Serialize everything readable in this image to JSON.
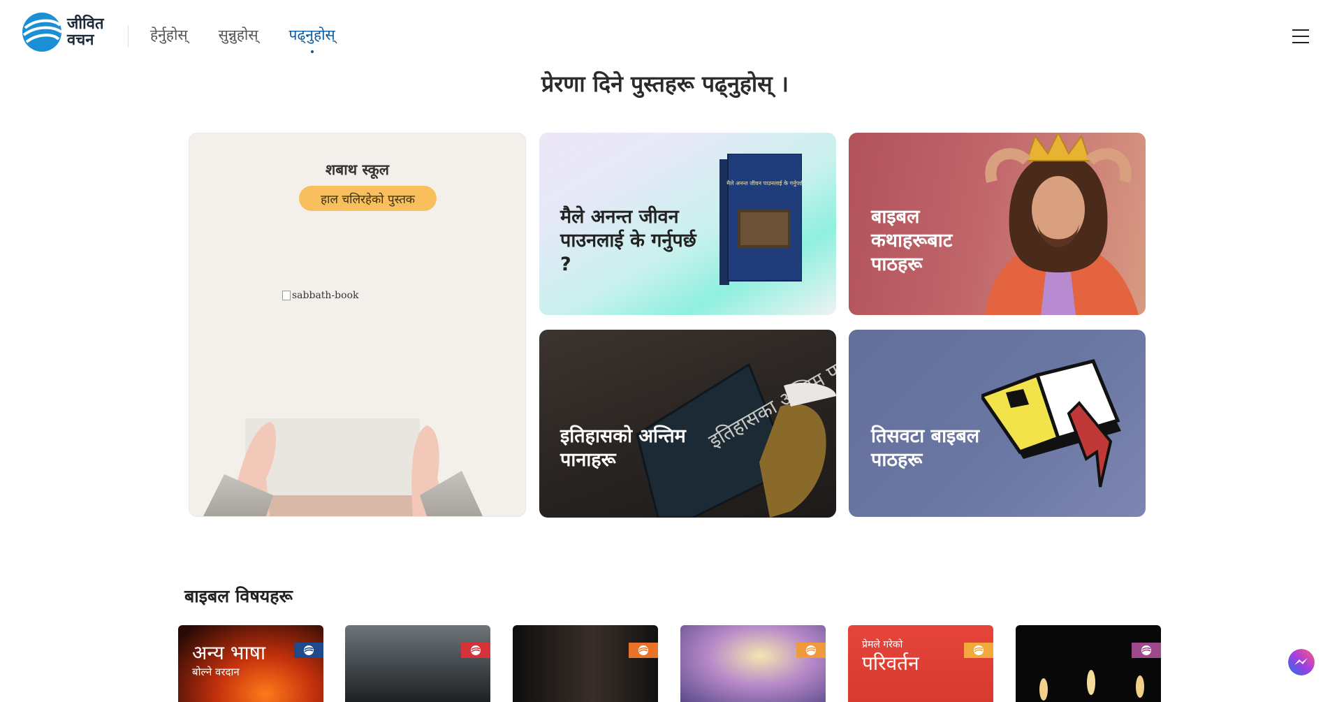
{
  "header": {
    "logo_line1": "जीवित",
    "logo_line2": "वचन",
    "nav": [
      {
        "label": "हेर्नुहोस्",
        "active": false
      },
      {
        "label": "सुन्नुहोस्",
        "active": false
      },
      {
        "label": "पढ्नुहोस्",
        "active": true
      }
    ],
    "menu_icon": "hamburger-icon"
  },
  "main": {
    "title": "प्रेरणा दिने पुस्तहरू पढ्नुहोस् ।",
    "sabbath_card": {
      "title": "शबाथ स्कूल",
      "pill": "हाल चलिरहेको पुस्तक",
      "image_alt": "sabbath-book"
    },
    "cards": {
      "eternal_life": {
        "label": "मैले अनन्त जीवन पाउनलाई के गर्नुपर्छ ?",
        "cover_text": "मैले अनन्त जीवन पाउनलाई के गर्नुपर्छ"
      },
      "bible_stories": {
        "label": "बाइबल कथाहरूबाट पाठहरू"
      },
      "history_pages": {
        "label": "इतिहासको अन्तिम पानाहरू",
        "cover_text": "इतिहासका अन्तिम पानाहरू"
      },
      "three_studies": {
        "label": "तिसवटा बाइबल पाठहरू"
      }
    }
  },
  "topics_section": {
    "title": "बाइबल विषयहरू",
    "items": [
      {
        "title": "अन्य भाषा",
        "subtitle": "बोल्ने वरदान",
        "badge_color": "#1f4a8c"
      },
      {
        "title": "",
        "subtitle": "",
        "badge_color": "#d5323a"
      },
      {
        "title": "",
        "subtitle": "",
        "badge_color": "#e8742a"
      },
      {
        "title": "",
        "subtitle": "",
        "badge_color": "#f09a3e"
      },
      {
        "title": "परिवर्तन",
        "subtitle": "प्रेमले गरेको",
        "badge_color": "#f0a93a"
      },
      {
        "title": "",
        "subtitle": "",
        "badge_color": "#9c4a8c"
      }
    ]
  },
  "colors": {
    "accent": "#0a5a9c",
    "pill": "#f9bf5c"
  }
}
